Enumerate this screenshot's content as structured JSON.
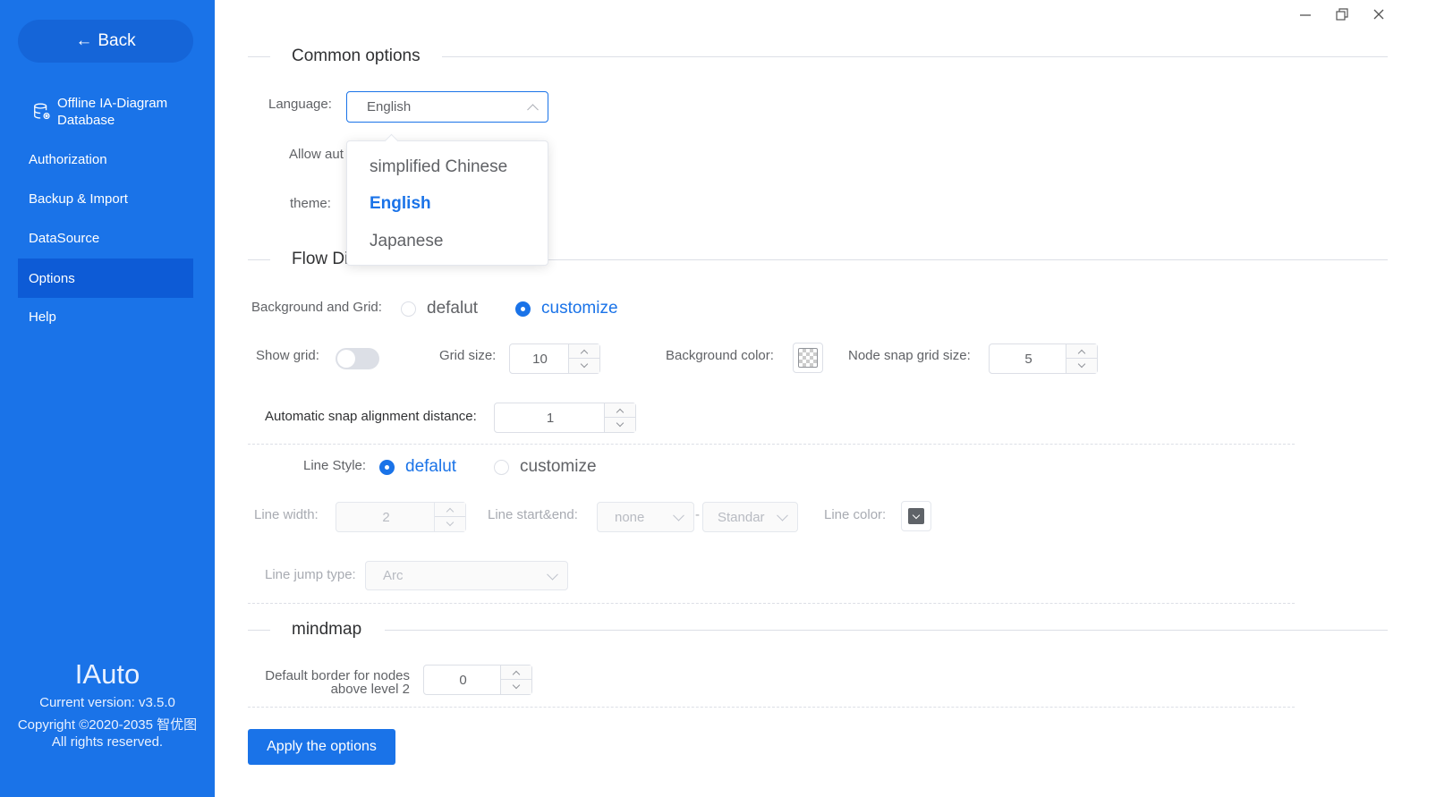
{
  "sidebar": {
    "back_label": "Back",
    "items": [
      {
        "label": "Offline IA-Diagram Database",
        "line1": "Offline IA-Diagram",
        "line2": "Database"
      },
      {
        "label": "Authorization"
      },
      {
        "label": "Backup & Import"
      },
      {
        "label": "DataSource"
      },
      {
        "label": "Options",
        "active": true
      },
      {
        "label": "Help"
      }
    ],
    "brand": "IAuto",
    "version": "Current version: v3.5.0",
    "copyright": "Copyright ©2020-2035 智优图",
    "rights": "All rights reserved."
  },
  "common": {
    "title": "Common options",
    "language_label": "Language:",
    "language_value": "English",
    "language_options": [
      "simplified Chinese",
      "English",
      "Japanese"
    ],
    "allow_label": "Allow aut",
    "theme_label": "theme:"
  },
  "flow": {
    "title_visible": "Flow Di",
    "bg_grid_label": "Background and Grid:",
    "bg_options": [
      "defalut",
      "customize"
    ],
    "bg_selected": "customize",
    "show_grid_label": "Show grid:",
    "show_grid": false,
    "grid_size_label": "Grid size:",
    "grid_size": "10",
    "bg_color_label": "Background color:",
    "snap_grid_label": "Node snap grid size:",
    "snap_grid": "5",
    "auto_snap_label": "Automatic snap alignment distance:",
    "auto_snap": "1",
    "line_style_label": "Line Style:",
    "line_style_options": [
      "defalut",
      "customize"
    ],
    "line_style_selected": "defalut",
    "line_width_label": "Line width:",
    "line_width": "2",
    "line_start_end_label": "Line start&end:",
    "line_start": "none",
    "line_end": "Standar",
    "line_dash": "-",
    "line_color_label": "Line color:",
    "line_jump_label": "Line jump type:",
    "line_jump": "Arc"
  },
  "mindmap": {
    "title": "mindmap",
    "border_label_line1": "Default border for nodes",
    "border_label_line2": "above level 2",
    "border_value": "0"
  },
  "apply_label": "Apply the options",
  "colors": {
    "sidebar": "#1a73e8",
    "accent": "#1a73e8",
    "active_item": "#0d5bd6"
  }
}
